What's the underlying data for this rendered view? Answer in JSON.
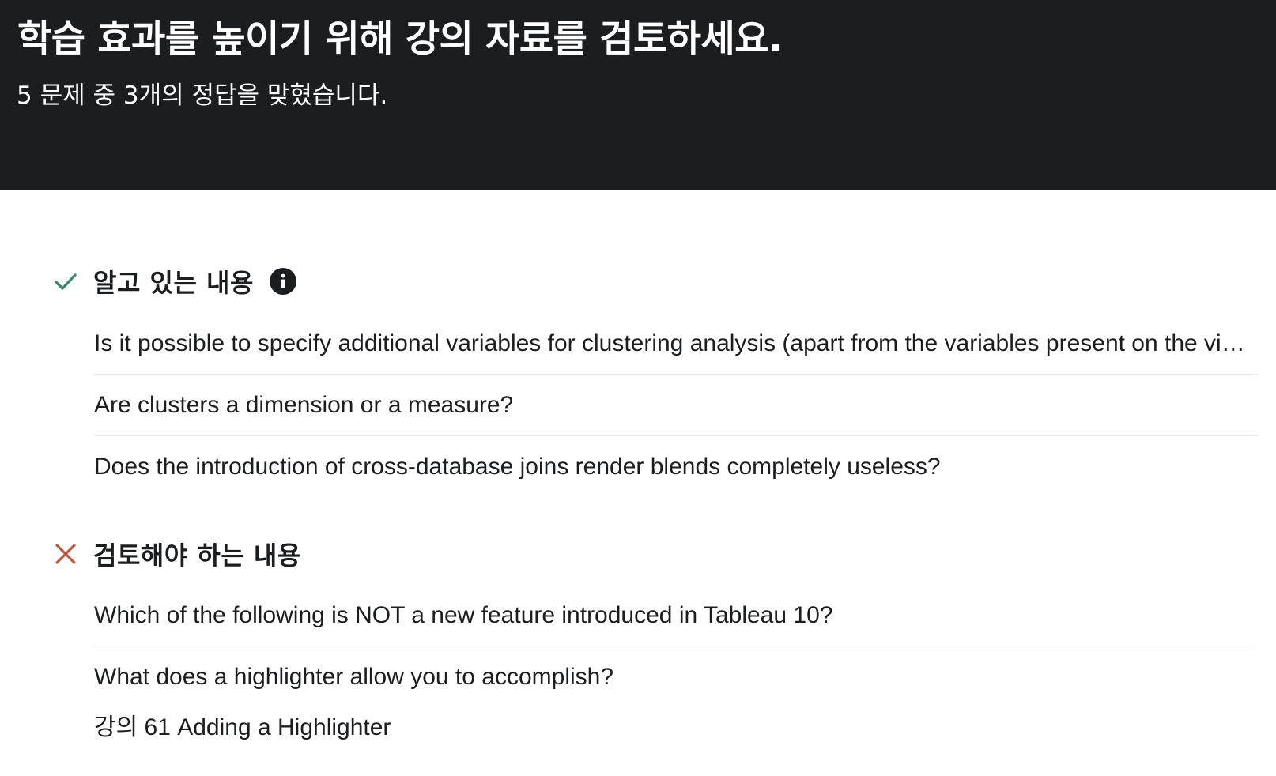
{
  "hero": {
    "title": "학습 효과를 높이기 위해 강의 자료를 검토하세요.",
    "subtitle": "5 문제 중 3개의 정답을 맞혔습니다."
  },
  "known": {
    "title": "알고 있는 내용",
    "icon": "check-icon",
    "icon_color": "#3d8a6a",
    "info_icon": "info-icon",
    "items": [
      "Is it possible to specify additional variables for clustering analysis (apart from the variables present on the view)?",
      "Are clusters a dimension or a measure?",
      "Does the introduction of cross-database joins render blends completely useless?"
    ]
  },
  "review": {
    "title": "검토해야 하는 내용",
    "icon": "x-icon",
    "icon_color": "#c4553a",
    "items": [
      "Which of the following is NOT a new feature introduced in Tableau 10?",
      "What does a highlighter allow you to accomplish?"
    ],
    "lecture_link": "강의 61 Adding a Highlighter"
  }
}
